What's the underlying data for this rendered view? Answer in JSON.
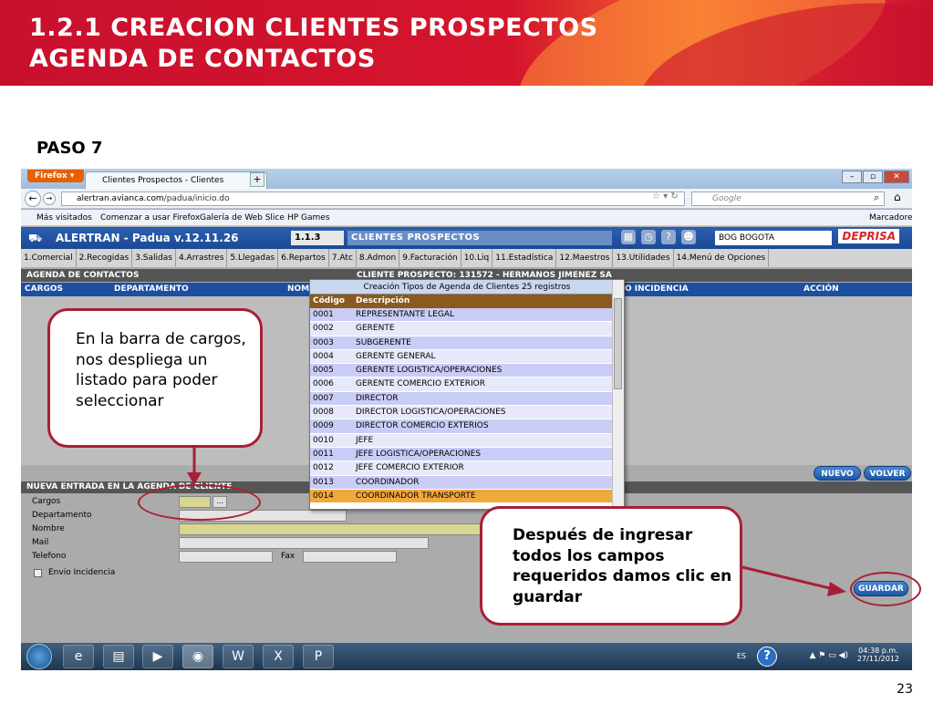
{
  "slide": {
    "title_line1": "1.2.1 CREACION CLIENTES PROSPECTOS",
    "title_line2": "AGENDA DE CONTACTOS",
    "step": "PASO 7",
    "page_number": "23",
    "callout_left": "En la barra de cargos, nos despliega un listado para poder seleccionar",
    "callout_right": "Después de ingresar todos los campos requeridos damos clic en guardar"
  },
  "browser": {
    "menu_button": "Firefox",
    "tab_title": "Clientes Prospectos - Clientes Prospectos",
    "new_tab": "+",
    "url_domain": "alertran.avianca.com",
    "url_path": "/padua/inicio.do",
    "search_placeholder": "Google",
    "bookmarks": [
      "Más visitados",
      "Comenzar a usar Firefox",
      "Galería de Web Slice",
      "HP Games"
    ],
    "bookmarks_menu": "Marcadores"
  },
  "app": {
    "title": "ALERTRAN - Padua  v.12.11.26",
    "code": "1.1.3",
    "module": "CLIENTES PROSPECTOS",
    "city": "BOG BOGOTA",
    "logo": "DEPRISA",
    "menu": [
      "1.Comercial",
      "2.Recogidas",
      "3.Salidas",
      "4.Arrastres",
      "5.Llegadas",
      "6.Repartos",
      "7.Atc",
      "8.Admon",
      "9.Facturación",
      "10.Liq",
      "11.Estadística",
      "12.Maestros",
      "13.Utilidades",
      "14.Menú de Opciones"
    ],
    "section_agenda": "AGENDA DE CONTACTOS",
    "prospect_label": "CLIENTE PROSPECTO: 131572 - HERMANOS JIMENEZ SA",
    "columns": [
      "CARGOS",
      "DEPARTAMENTO",
      "NOM",
      "O INCIDENCIA",
      "ACCIÓN"
    ],
    "btn_nuevo": "NUEVO",
    "btn_volver": "VOLVER",
    "section_new": "NUEVA ENTRADA EN LA AGENDA DE CLIENTE",
    "form": {
      "cargos": "Cargos",
      "departamento": "Departamento",
      "nombre": "Nombre",
      "mail": "Mail",
      "telefono": "Telefono",
      "fax": "Fax",
      "envio": "Envio Incidencia",
      "lookup": "..."
    },
    "btn_guardar": "GUARDAR"
  },
  "dropdown": {
    "title": "Creación Tipos de Agenda de Clientes 25 registros",
    "header_code": "Código",
    "header_desc": "Descripción",
    "rows": [
      {
        "code": "0001",
        "desc": "REPRESENTANTE LEGAL"
      },
      {
        "code": "0002",
        "desc": "GERENTE"
      },
      {
        "code": "0003",
        "desc": "SUBGERENTE"
      },
      {
        "code": "0004",
        "desc": "GERENTE GENERAL"
      },
      {
        "code": "0005",
        "desc": "GERENTE LOGISTICA/OPERACIONES"
      },
      {
        "code": "0006",
        "desc": "GERENTE COMERCIO EXTERIOR"
      },
      {
        "code": "0007",
        "desc": "DIRECTOR"
      },
      {
        "code": "0008",
        "desc": "DIRECTOR LOGISTICA/OPERACIONES"
      },
      {
        "code": "0009",
        "desc": "DIRECTOR COMERCIO EXTERIOS"
      },
      {
        "code": "0010",
        "desc": "JEFE"
      },
      {
        "code": "0011",
        "desc": "JEFE LOGISTICA/OPERACIONES"
      },
      {
        "code": "0012",
        "desc": "JEFE COMERCIO EXTERIOR"
      },
      {
        "code": "0013",
        "desc": "COORDINADOR"
      },
      {
        "code": "0014",
        "desc": "COORDINADOR TRANSPORTE"
      }
    ]
  },
  "taskbar": {
    "lang": "ES",
    "time": "04:38 p.m.",
    "date": "27/11/2012"
  },
  "colors": {
    "brand_red": "#c8102e",
    "accent_orange": "#f26a2c",
    "app_blue": "#1c4fa0",
    "callout_border": "#a81f35"
  }
}
